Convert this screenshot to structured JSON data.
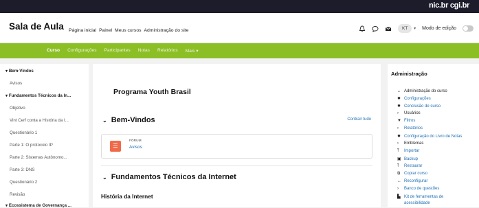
{
  "topbar": {
    "logos": "nic.br  cgi.br"
  },
  "header": {
    "brand": "Sala de Aula",
    "nav": [
      "Página inicial",
      "Painel",
      "Meus cursos",
      "Administração do site"
    ],
    "avatar_initials": "KT",
    "edit_mode_label": "Modo de edição"
  },
  "course_nav": {
    "items": [
      "Curso",
      "Configurações",
      "Participantes",
      "Notas",
      "Relatórios",
      "Mais"
    ],
    "more_caret": "▾"
  },
  "left_index": [
    {
      "label": "Bem-Vindos",
      "section": true
    },
    {
      "label": "Avisos",
      "section": false
    },
    {
      "label": "Fundamentos Técnicos da In...",
      "section": true
    },
    {
      "label": "Objetivo",
      "section": false
    },
    {
      "label": "Vint Cerf conta a História da I...",
      "section": false
    },
    {
      "label": "Questionário 1",
      "section": false
    },
    {
      "label": "Parte 1: O protocolo IP",
      "section": false
    },
    {
      "label": "Parte 2: Sistemas Autônomo...",
      "section": false
    },
    {
      "label": "Parte 3: DNS",
      "section": false
    },
    {
      "label": "Questionário 2",
      "section": false
    },
    {
      "label": "Revisão",
      "section": false
    },
    {
      "label": "Ecossistema de Governança ...",
      "section": true
    }
  ],
  "main": {
    "course_title": "Programa Youth Brasil",
    "section1": "Bem-Vindos",
    "collapse_all": "Contrair tudo",
    "activity": {
      "type": "FÓRUM",
      "name": "Avisos"
    },
    "section2": "Fundamentos Técnicos da Internet",
    "subsection": "História da Internet"
  },
  "admin": {
    "title": "Administração",
    "items": [
      {
        "label": "Administração do curso",
        "kind": "plain",
        "icon": "⌄"
      },
      {
        "label": "Configurações",
        "kind": "link",
        "icon": "✹"
      },
      {
        "label": "Conclusão de curso",
        "kind": "link",
        "icon": "✹"
      },
      {
        "label": "Usuários",
        "kind": "plain",
        "icon": "›"
      },
      {
        "label": "Filtros",
        "kind": "link",
        "icon": "▼"
      },
      {
        "label": "Relatórios",
        "kind": "link",
        "icon": "›"
      },
      {
        "label": "Configuração do Livro de Notas",
        "kind": "link",
        "icon": "✹"
      },
      {
        "label": "Emblemas",
        "kind": "plain",
        "icon": "›"
      },
      {
        "label": "Importar",
        "kind": "link",
        "icon": "⤒"
      },
      {
        "label": "Backup",
        "kind": "link",
        "icon": "▣"
      },
      {
        "label": "Restaurar",
        "kind": "link",
        "icon": "⤒"
      },
      {
        "label": "Copiar curso",
        "kind": "link",
        "icon": "⧉"
      },
      {
        "label": "Reconfigurar",
        "kind": "link",
        "icon": "←"
      },
      {
        "label": "Banco de questões",
        "kind": "link",
        "icon": "›"
      },
      {
        "label": "Kit de ferramentas de",
        "kind": "link",
        "icon": "▙"
      },
      {
        "label": "acessibilidade",
        "kind": "link",
        "icon": ""
      }
    ]
  },
  "colors": {
    "accent_green": "#8cbf26",
    "link_blue": "#1f6fb3",
    "forum_icon": "#f06a4a",
    "topbar": "#1c1c2b"
  },
  "icons": [
    "notification-bell-icon",
    "chat-bubble-icon",
    "envelope-icon",
    "forum-icon",
    "chevron-down-icon"
  ]
}
